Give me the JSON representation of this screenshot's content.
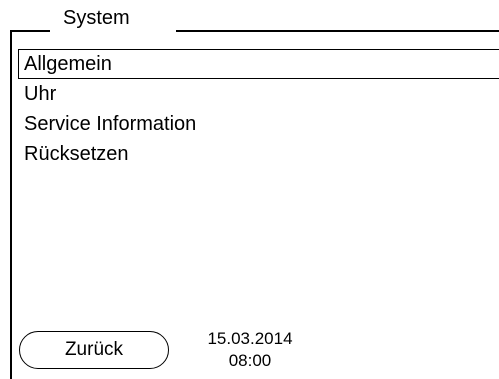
{
  "window": {
    "title": "System"
  },
  "menu": {
    "items": [
      {
        "label": "Allgemein",
        "selected": true
      },
      {
        "label": "Uhr",
        "selected": false
      },
      {
        "label": "Service Information",
        "selected": false
      },
      {
        "label": "Rücksetzen",
        "selected": false
      }
    ]
  },
  "footer": {
    "back_label": "Zurück",
    "date": "15.03.2014",
    "time": "08:00"
  }
}
